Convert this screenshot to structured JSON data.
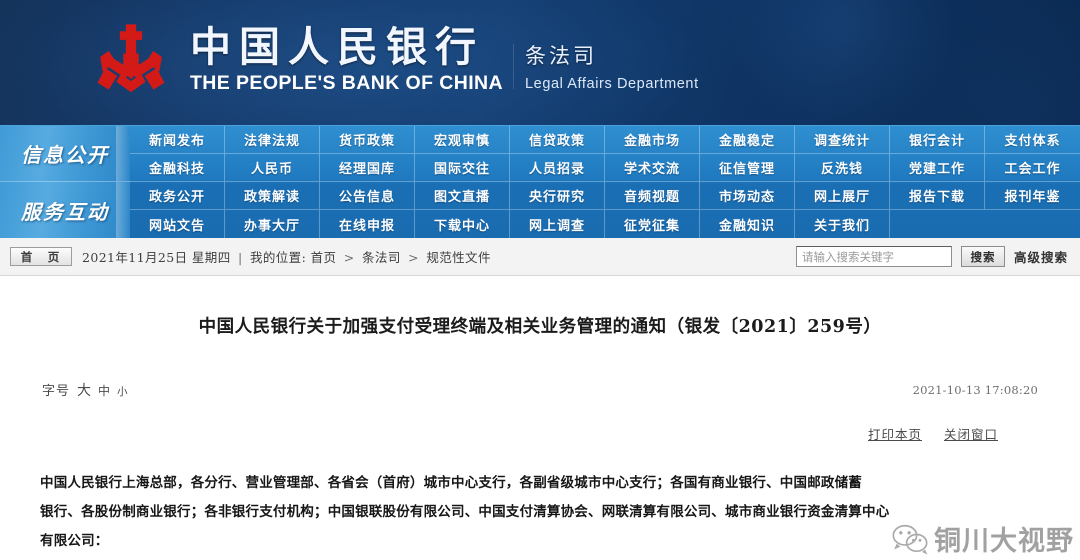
{
  "banner": {
    "emblem_icon": "pboc-emblem-icon",
    "title_cn": "中国人民银行",
    "title_en": "THE PEOPLE'S BANK OF CHINA",
    "department_cn": "条法司",
    "department_en": "Legal Affairs Department",
    "bg_color": "#10366a"
  },
  "nav": {
    "groups": [
      {
        "label": "信息公开"
      },
      {
        "label": "服务互动"
      }
    ],
    "rows": [
      [
        "新闻发布",
        "法律法规",
        "货币政策",
        "宏观审慎",
        "信贷政策",
        "金融市场",
        "金融稳定",
        "调查统计",
        "银行会计",
        "支付体系"
      ],
      [
        "金融科技",
        "人民币",
        "经理国库",
        "国际交往",
        "人员招录",
        "学术交流",
        "征信管理",
        "反洗钱",
        "党建工作",
        "工会工作"
      ],
      [
        "政务公开",
        "政策解读",
        "公告信息",
        "图文直播",
        "央行研究",
        "音频视题",
        "市场动态",
        "网上展厅",
        "报告下载",
        "报刊年鉴"
      ],
      [
        "网站文告",
        "办事大厅",
        "在线申报",
        "下载中心",
        "网上调查",
        "征党征集",
        "金融知识",
        "关于我们",
        "",
        ""
      ]
    ]
  },
  "crumb": {
    "home_label": "首　页",
    "date": "2021年11月25日 星期四",
    "divider": "|",
    "location_label": "我的位置:",
    "path": [
      "首页",
      "条法司",
      "规范性文件"
    ],
    "separator": ">"
  },
  "search": {
    "placeholder": "请输入搜索关键字",
    "value": "",
    "button_label": "搜索",
    "advanced_label": "高级搜索"
  },
  "article": {
    "title": "中国人民银行关于加强支付受理终端及相关业务管理的通知（银发〔2021〕259号）",
    "fontsize_label": "字号",
    "fontsize_options": [
      "大",
      "中",
      "小"
    ],
    "publish_time": "2021-10-13 17:08:20",
    "tools": [
      "打印本页",
      "关闭窗口"
    ],
    "paragraphs": [
      "中国人民银行上海总部，各分行、营业管理部、各省会（首府）城市中心支行，各副省级城市中心支行；各国有商业银行、中国邮政储蓄",
      "银行、各股份制商业银行；各非银行支付机构；中国银联股份有限公司、中国支付清算协会、网联清算有限公司、城市商业银行资金清算中心",
      "有限公司："
    ]
  },
  "watermark": {
    "icon": "wechat-icon",
    "text": "铜川大视野"
  }
}
